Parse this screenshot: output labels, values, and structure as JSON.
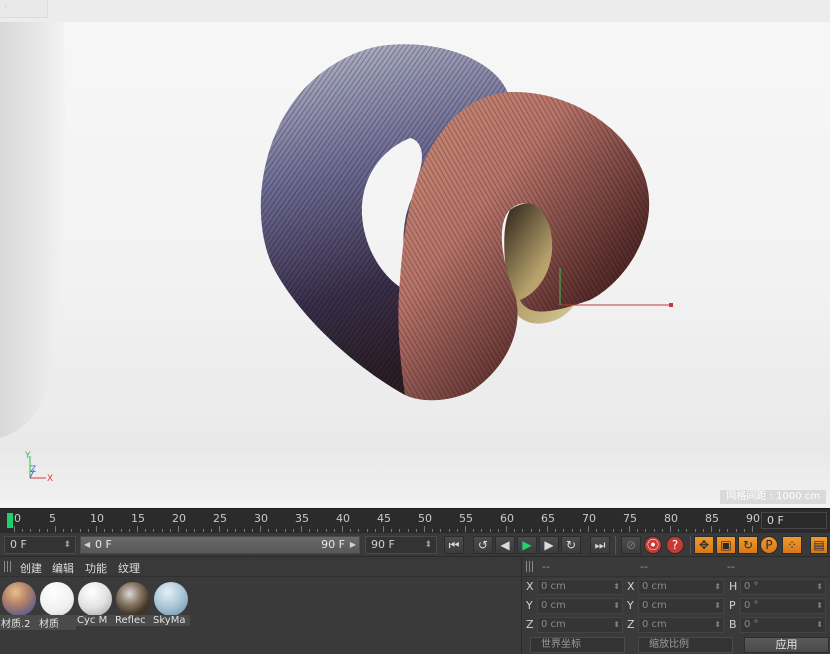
{
  "viewport": {
    "tab_label": "·",
    "grid_info": "网格间距 : 1000 cm",
    "axis": {
      "y": "Y",
      "z": "Z",
      "x": "X"
    }
  },
  "timeline": {
    "ticks": [
      "0",
      "5",
      "10",
      "15",
      "20",
      "25",
      "30",
      "35",
      "40",
      "45",
      "50",
      "55",
      "60",
      "65",
      "70",
      "75",
      "80",
      "85",
      "90"
    ],
    "current_frame": "0 F"
  },
  "transport": {
    "start_field": "0 F",
    "range_start": "0 F",
    "range_end": "90 F",
    "end_field": "90 F",
    "buttons": {
      "go_start": "⏮",
      "prev_key": "↺",
      "prev_frame": "◀",
      "play": "▶",
      "next_frame": "▶",
      "next_key": "↻",
      "go_end": "⏭"
    }
  },
  "materials": {
    "menu": [
      "创建",
      "编辑",
      "功能",
      "纹理"
    ],
    "items": [
      {
        "label": "材质.2"
      },
      {
        "label": "材质"
      },
      {
        "label": "Cyc M"
      },
      {
        "label": "Reflec"
      },
      {
        "label": "SkyMa"
      }
    ]
  },
  "coordinates": {
    "head": [
      "--",
      "--",
      "--"
    ],
    "rows": [
      {
        "a_label": "X",
        "a_value": "0 cm",
        "b_label": "X",
        "b_value": "0 cm",
        "c_label": "H",
        "c_value": "0 °"
      },
      {
        "a_label": "Y",
        "a_value": "0 cm",
        "b_label": "Y",
        "b_value": "0 cm",
        "c_label": "P",
        "c_value": "0 °"
      },
      {
        "a_label": "Z",
        "a_value": "0 cm",
        "b_label": "Z",
        "b_value": "0 cm",
        "c_label": "B",
        "c_value": "0 °"
      }
    ],
    "mode_select": "世界坐标",
    "scale_select": "缩放比例",
    "apply_label": "应用"
  }
}
